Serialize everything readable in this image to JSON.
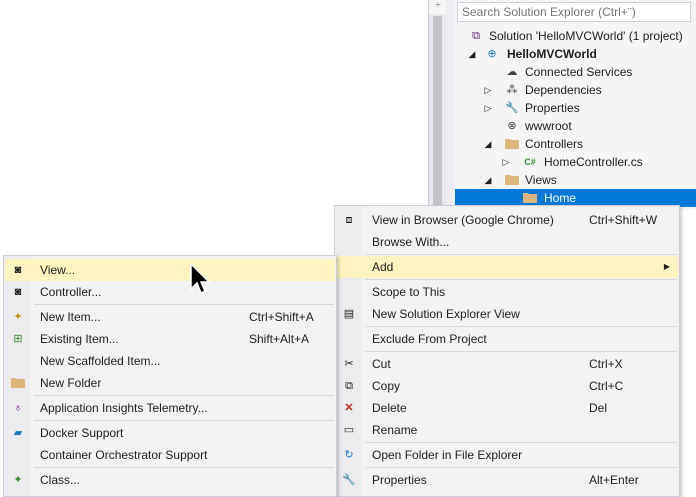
{
  "editor": {
    "scroll_button_glyph": "÷"
  },
  "solution_explorer": {
    "search_placeholder": "Search Solution Explorer (Ctrl+¨)",
    "tree": [
      {
        "label": "Solution 'HelloMVCWorld' (1 project)",
        "icon": "solution-icon",
        "arrow": "",
        "bold": false,
        "selected": false
      },
      {
        "label": "HelloMVCWorld",
        "icon": "web-project-icon",
        "arrow": "◢",
        "bold": true,
        "selected": false
      },
      {
        "label": "Connected Services",
        "icon": "cloud-icon",
        "arrow": "",
        "bold": false,
        "selected": false
      },
      {
        "label": "Dependencies",
        "icon": "dependencies-icon",
        "arrow": "▷",
        "bold": false,
        "selected": false
      },
      {
        "label": "Properties",
        "icon": "wrench-icon",
        "arrow": "▷",
        "bold": false,
        "selected": false
      },
      {
        "label": "wwwroot",
        "icon": "globe-icon",
        "arrow": "",
        "bold": false,
        "selected": false
      },
      {
        "label": "Controllers",
        "icon": "folder-icon",
        "arrow": "◢",
        "bold": false,
        "selected": false
      },
      {
        "label": "HomeController.cs",
        "icon": "csharp-file-icon",
        "arrow": "▷",
        "bold": false,
        "selected": false
      },
      {
        "label": "Views",
        "icon": "folder-icon",
        "arrow": "◢",
        "bold": false,
        "selected": false
      },
      {
        "label": "Home",
        "icon": "folder-icon",
        "arrow": "",
        "bold": false,
        "selected": true
      }
    ]
  },
  "context_menu": {
    "items": [
      {
        "label": "View in Browser (Google Chrome)",
        "shortcut": "Ctrl+Shift+W",
        "icon": "browser-icon"
      },
      {
        "label": "Browse With...",
        "shortcut": "",
        "icon": ""
      },
      {
        "label": "Add",
        "shortcut": "",
        "icon": "",
        "submenu_arrow": "▶"
      },
      {
        "label": "Scope to This",
        "shortcut": "",
        "icon": ""
      },
      {
        "label": "New Solution Explorer View",
        "shortcut": "",
        "icon": "new-view-icon"
      },
      {
        "label": "Exclude From Project",
        "shortcut": "",
        "icon": ""
      },
      {
        "label": "Cut",
        "shortcut": "Ctrl+X",
        "icon": "scissors-icon"
      },
      {
        "label": "Copy",
        "shortcut": "Ctrl+C",
        "icon": "copy-icon"
      },
      {
        "label": "Delete",
        "shortcut": "Del",
        "icon": "delete-x-icon"
      },
      {
        "label": "Rename",
        "shortcut": "",
        "icon": "rename-icon"
      },
      {
        "label": "Open Folder in File Explorer",
        "shortcut": "",
        "icon": "refresh-arrow-icon"
      },
      {
        "label": "Properties",
        "shortcut": "Alt+Enter",
        "icon": "wrench-icon"
      }
    ]
  },
  "add_submenu": {
    "items": [
      {
        "label": "View...",
        "shortcut": "",
        "icon": "view-file-icon"
      },
      {
        "label": "Controller...",
        "shortcut": "",
        "icon": "controller-file-icon"
      },
      {
        "label": "New Item...",
        "shortcut": "Ctrl+Shift+A",
        "icon": "new-item-icon"
      },
      {
        "label": "Existing Item...",
        "shortcut": "Shift+Alt+A",
        "icon": "existing-item-icon"
      },
      {
        "label": "New Scaffolded Item...",
        "shortcut": "",
        "icon": ""
      },
      {
        "label": "New Folder",
        "shortcut": "",
        "icon": "new-folder-icon"
      },
      {
        "label": "Application Insights Telemetry...",
        "shortcut": "",
        "icon": "app-insights-icon"
      },
      {
        "label": "Docker Support",
        "shortcut": "",
        "icon": "docker-icon"
      },
      {
        "label": "Container Orchestrator Support",
        "shortcut": "",
        "icon": ""
      },
      {
        "label": "Class...",
        "shortcut": "",
        "icon": "class-icon"
      }
    ]
  },
  "colors": {
    "selection": "#0078d7",
    "menu_highlight": "#fdf4bf",
    "menu_background": "#f2f2f2"
  }
}
